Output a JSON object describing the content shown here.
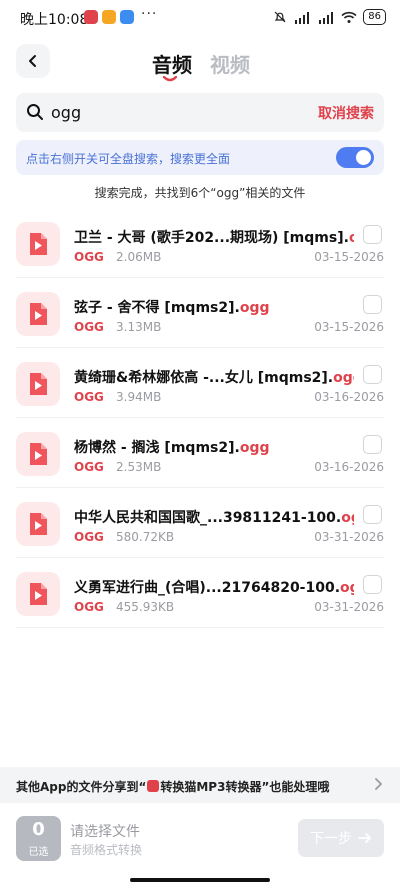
{
  "status_bar": {
    "time": "晚上10:08",
    "dots": "···",
    "battery": "86",
    "app_icon_colors": [
      "#e0424b",
      "#f5a623",
      "#3b8ef0"
    ]
  },
  "header": {
    "tabs": [
      {
        "label": "音频",
        "active": true
      },
      {
        "label": "视频",
        "active": false
      }
    ]
  },
  "search": {
    "value": "ogg",
    "cancel_label": "取消搜索"
  },
  "banner": {
    "text": "点击右侧开关可全盘搜索，搜索更全面",
    "toggle_on": true
  },
  "result_summary": "搜索完成，共找到6个“ogg”相关的文件",
  "files": [
    {
      "name": "卫兰 - 大哥 (歌手202...期现场) [mqms].",
      "ext": "ogg",
      "type": "OGG",
      "size": "2.06MB",
      "date": "03-15-2026"
    },
    {
      "name": "弦子 - 舍不得 [mqms2].",
      "ext": "ogg",
      "type": "OGG",
      "size": "3.13MB",
      "date": "03-15-2026"
    },
    {
      "name": "黄绮珊&希林娜依高 -...女儿 [mqms2].",
      "ext": "ogg",
      "type": "OGG",
      "size": "3.94MB",
      "date": "03-16-2026"
    },
    {
      "name": "杨博然 - 搁浅 [mqms2].",
      "ext": "ogg",
      "type": "OGG",
      "size": "2.53MB",
      "date": "03-16-2026"
    },
    {
      "name": "中华人民共和国国歌_...39811241-100.",
      "ext": "ogg",
      "type": "OGG",
      "size": "580.72KB",
      "date": "03-31-2026"
    },
    {
      "name": "义勇军进行曲_(合唱)...21764820-100.",
      "ext": "ogg",
      "type": "OGG",
      "size": "455.93KB",
      "date": "03-31-2026"
    }
  ],
  "share_bar": {
    "prefix": "其他App的文件分享到“",
    "app_name": "转换猫MP3转换器",
    "suffix": "”也能处理哦"
  },
  "bottom": {
    "selected_count": "0",
    "selected_label": "已选",
    "choose_title": "请选择文件",
    "choose_sub": "音频格式转换",
    "next_label": "下一步"
  },
  "colors": {
    "accent_red": "#e0424b",
    "toggle_blue": "#4f7cf0",
    "banner_text": "#4a72d6"
  }
}
